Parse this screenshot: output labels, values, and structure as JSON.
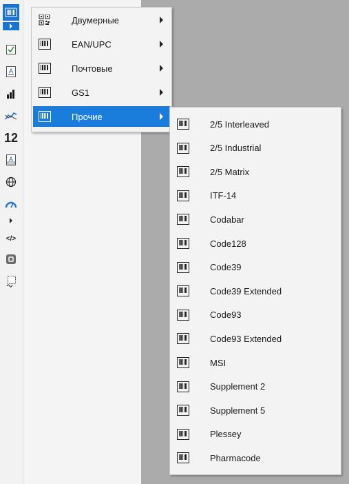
{
  "colors": {
    "accent": "#1b7ddb",
    "menu_bg": "#f3f3f3",
    "toolbar_bg": "#f2f2f2",
    "backdrop": "#ababab"
  },
  "toolbar": {
    "items": [
      {
        "icon": "barcode-icon",
        "active": true
      },
      {
        "icon": "checkbox-icon"
      },
      {
        "icon": "text-icon"
      },
      {
        "icon": "bar-chart-icon"
      },
      {
        "icon": "sparkline-icon"
      },
      {
        "icon": "number-icon",
        "text": "12"
      },
      {
        "icon": "text-field-icon"
      },
      {
        "icon": "globe-icon"
      },
      {
        "icon": "gauge-icon"
      },
      {
        "icon": "expand-icon"
      },
      {
        "icon": "code-icon",
        "text": "</>"
      },
      {
        "icon": "shape-icon"
      },
      {
        "icon": "signature-icon"
      }
    ]
  },
  "menu": {
    "items": [
      {
        "label": "Двумерные",
        "icon": "qr-code-icon",
        "submenu": true
      },
      {
        "label": "EAN/UPC",
        "icon": "barcode-icon",
        "submenu": true
      },
      {
        "label": "Почтовые",
        "icon": "barcode-icon",
        "submenu": true
      },
      {
        "label": "GS1",
        "icon": "barcode-icon",
        "submenu": true
      },
      {
        "label": "Прочие",
        "icon": "barcode-icon",
        "submenu": true,
        "active": true
      }
    ]
  },
  "submenu": {
    "items": [
      {
        "label": "2/5 Interleaved"
      },
      {
        "label": "2/5 Industrial"
      },
      {
        "label": "2/5 Matrix"
      },
      {
        "label": "ITF-14"
      },
      {
        "label": "Codabar"
      },
      {
        "label": "Code128"
      },
      {
        "label": "Code39"
      },
      {
        "label": "Code39 Extended"
      },
      {
        "label": "Code93"
      },
      {
        "label": "Code93 Extended"
      },
      {
        "label": "MSI"
      },
      {
        "label": "Supplement 2"
      },
      {
        "label": "Supplement 5"
      },
      {
        "label": "Plessey"
      },
      {
        "label": "Pharmacode"
      }
    ]
  }
}
